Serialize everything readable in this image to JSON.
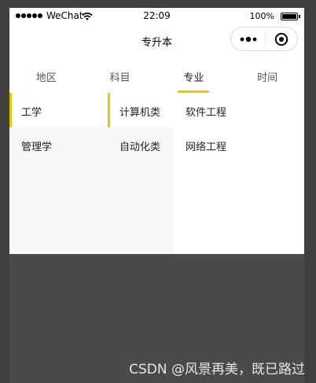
{
  "status_bar": {
    "carrier": "WeChat",
    "time": "22:09",
    "battery": "100%"
  },
  "nav": {
    "title": "专升本"
  },
  "tabs": [
    {
      "label": "地区"
    },
    {
      "label": "科目"
    },
    {
      "label": "专业"
    },
    {
      "label": "时间"
    }
  ],
  "active_tab": "专业",
  "columns": {
    "category": [
      {
        "label": "工学"
      },
      {
        "label": "管理学"
      }
    ],
    "subcategory": [
      {
        "label": "计算机类"
      },
      {
        "label": "自动化类"
      }
    ],
    "major": [
      {
        "label": "软件工程"
      },
      {
        "label": "网络工程"
      }
    ]
  },
  "colors": {
    "accent": "#f5c400",
    "panel_bg": "#f6f7f9",
    "overlay": "#4a4a4a"
  },
  "watermark": "CSDN @风景再美，既已路过"
}
